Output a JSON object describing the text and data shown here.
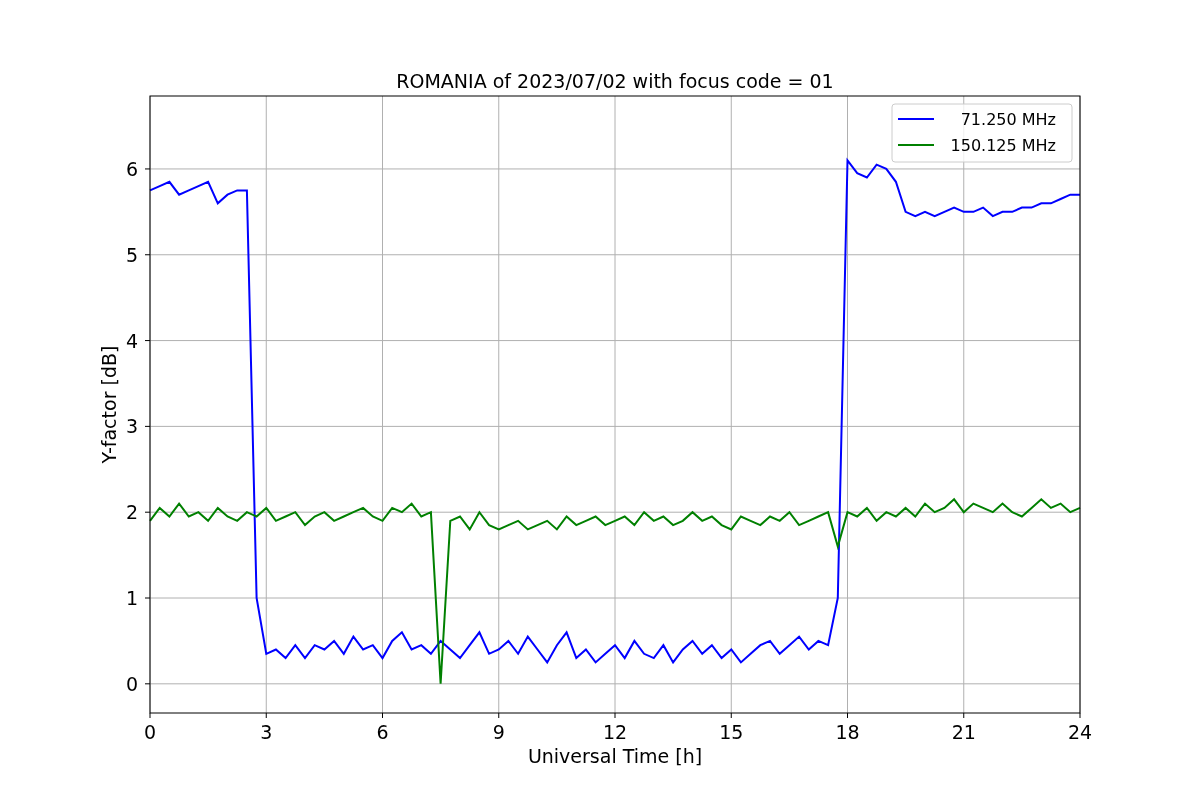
{
  "figure": {
    "chart_data": {
      "type": "line",
      "title": "ROMANIA of 2023/07/02 with focus code = 01",
      "xlabel": "Universal Time [h]",
      "ylabel": "Y-factor [dB]",
      "x": [
        0,
        0.25,
        0.5,
        0.75,
        1,
        1.25,
        1.5,
        1.75,
        2,
        2.25,
        2.5,
        2.75,
        3,
        3.25,
        3.5,
        3.75,
        4,
        4.25,
        4.5,
        4.75,
        5,
        5.25,
        5.5,
        5.75,
        6,
        6.25,
        6.5,
        6.75,
        7,
        7.25,
        7.5,
        7.75,
        8,
        8.25,
        8.5,
        8.75,
        9,
        9.25,
        9.5,
        9.75,
        10,
        10.25,
        10.5,
        10.75,
        11,
        11.25,
        11.5,
        11.75,
        12,
        12.25,
        12.5,
        12.75,
        13,
        13.25,
        13.5,
        13.75,
        14,
        14.25,
        14.5,
        14.75,
        15,
        15.25,
        15.5,
        15.75,
        16,
        16.25,
        16.5,
        16.75,
        17,
        17.25,
        17.5,
        17.75,
        18,
        18.25,
        18.5,
        18.75,
        19,
        19.25,
        19.5,
        19.75,
        20,
        20.25,
        20.5,
        20.75,
        21,
        21.25,
        21.5,
        21.75,
        22,
        22.25,
        22.5,
        22.75,
        23,
        23.25,
        23.5,
        23.75,
        24
      ],
      "series": [
        {
          "name": "71.250 MHz",
          "color": "#0000ff",
          "values": [
            5.75,
            5.8,
            5.85,
            5.7,
            5.75,
            5.8,
            5.85,
            5.6,
            5.7,
            5.75,
            5.75,
            1.0,
            0.35,
            0.4,
            0.3,
            0.45,
            0.3,
            0.45,
            0.4,
            0.5,
            0.35,
            0.55,
            0.4,
            0.45,
            0.3,
            0.5,
            0.6,
            0.4,
            0.45,
            0.35,
            0.5,
            0.4,
            0.3,
            0.45,
            0.6,
            0.35,
            0.4,
            0.5,
            0.35,
            0.55,
            0.4,
            0.25,
            0.45,
            0.6,
            0.3,
            0.4,
            0.25,
            0.35,
            0.45,
            0.3,
            0.5,
            0.35,
            0.3,
            0.45,
            0.25,
            0.4,
            0.5,
            0.35,
            0.45,
            0.3,
            0.4,
            0.25,
            0.35,
            0.45,
            0.5,
            0.35,
            0.45,
            0.55,
            0.4,
            0.5,
            0.45,
            1.0,
            6.1,
            5.95,
            5.9,
            6.05,
            6.0,
            5.85,
            5.5,
            5.45,
            5.5,
            5.45,
            5.5,
            5.55,
            5.5,
            5.5,
            5.55,
            5.45,
            5.5,
            5.5,
            5.55,
            5.55,
            5.6,
            5.6,
            5.65,
            5.7,
            5.7
          ]
        },
        {
          "name": "150.125 MHz",
          "color": "#008000",
          "values": [
            1.9,
            2.05,
            1.95,
            2.1,
            1.95,
            2.0,
            1.9,
            2.05,
            1.95,
            1.9,
            2.0,
            1.95,
            2.05,
            1.9,
            1.95,
            2.0,
            1.85,
            1.95,
            2.0,
            1.9,
            1.95,
            2.0,
            2.05,
            1.95,
            1.9,
            2.05,
            2.0,
            2.1,
            1.95,
            2.0,
            0.0,
            1.9,
            1.95,
            1.8,
            2.0,
            1.85,
            1.8,
            1.85,
            1.9,
            1.8,
            1.85,
            1.9,
            1.8,
            1.95,
            1.85,
            1.9,
            1.95,
            1.85,
            1.9,
            1.95,
            1.85,
            2.0,
            1.9,
            1.95,
            1.85,
            1.9,
            2.0,
            1.9,
            1.95,
            1.85,
            1.8,
            1.95,
            1.9,
            1.85,
            1.95,
            1.9,
            2.0,
            1.85,
            1.9,
            1.95,
            2.0,
            1.6,
            2.0,
            1.95,
            2.05,
            1.9,
            2.0,
            1.95,
            2.05,
            1.95,
            2.1,
            2.0,
            2.05,
            2.15,
            2.0,
            2.1,
            2.05,
            2.0,
            2.1,
            2.0,
            1.95,
            2.05,
            2.15,
            2.05,
            2.1,
            2.0,
            2.05
          ]
        }
      ],
      "grid": true,
      "legend": true,
      "xlim": [
        0,
        24
      ],
      "ylim": [
        -0.34,
        6.85
      ],
      "xticks": [
        0,
        3,
        6,
        9,
        12,
        15,
        18,
        21,
        24
      ],
      "yticks": [
        0,
        1,
        2,
        3,
        4,
        5,
        6
      ]
    }
  }
}
